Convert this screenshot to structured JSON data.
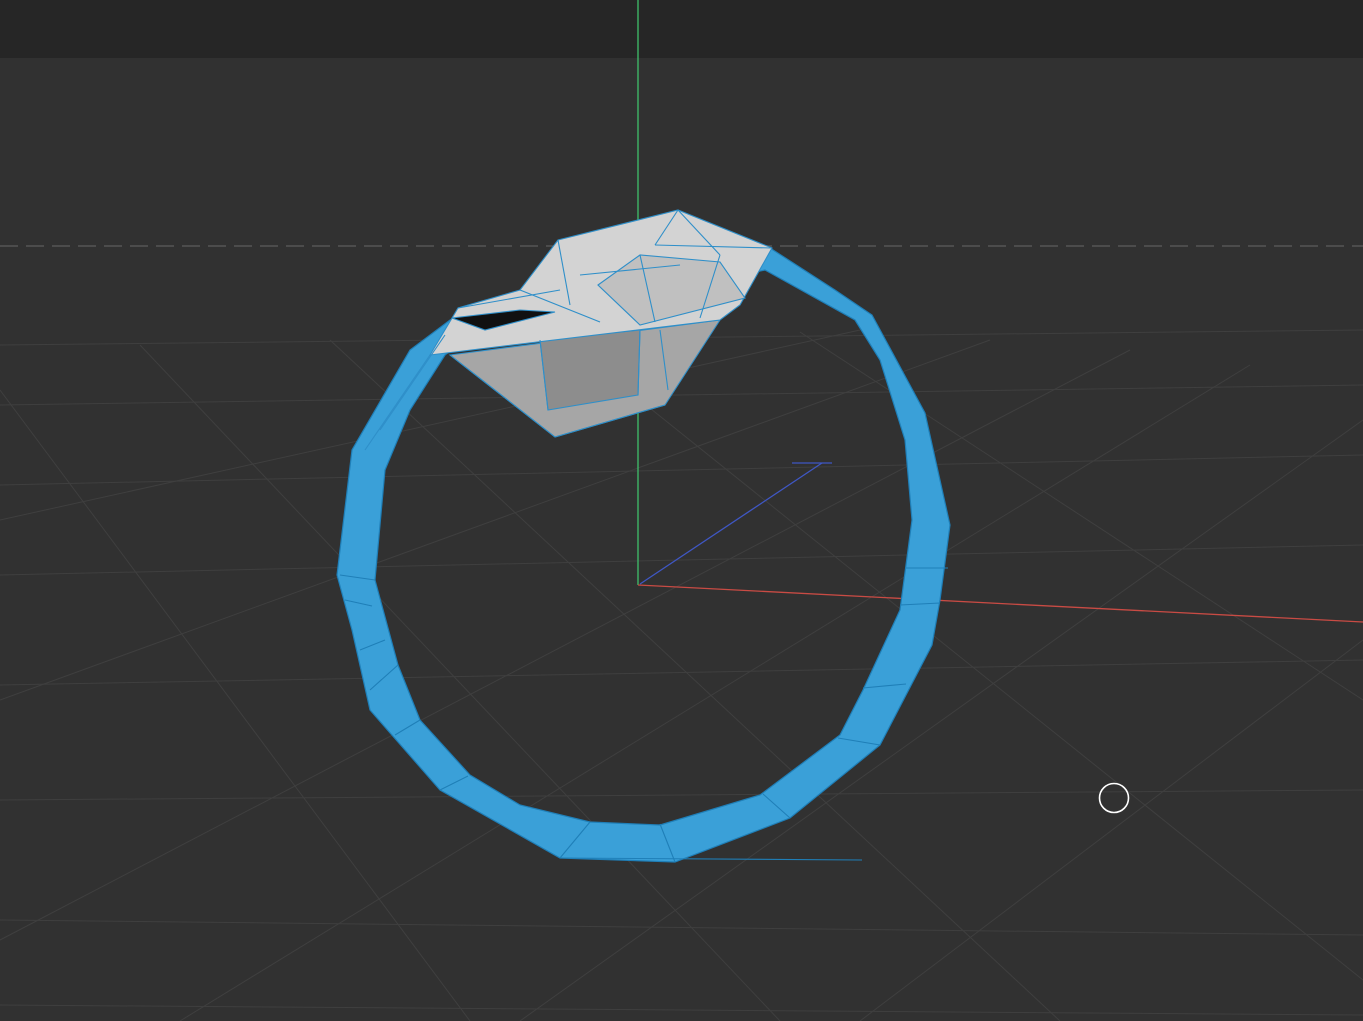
{
  "viewport": {
    "background_color": "#313131",
    "topbar_color": "#262626",
    "grid_color": "#3f3f3f",
    "horizon_color": "#555555",
    "axis_colors": {
      "x": "#c94b44",
      "y": "#3fbf6a",
      "z": "#3f57c4"
    },
    "selection_color": "#3aa0d8",
    "wire_color": "#1f7fb8",
    "stone_colors": {
      "light": "#d3d3d3",
      "mid": "#a6a6a6",
      "dark": "#8d8d8d",
      "cavity": "#111111"
    },
    "cursor_icon": "circle-cursor-icon"
  },
  "scene": {
    "selected_object": "ring-model",
    "parts": [
      "ring-band",
      "gem-setting"
    ]
  }
}
